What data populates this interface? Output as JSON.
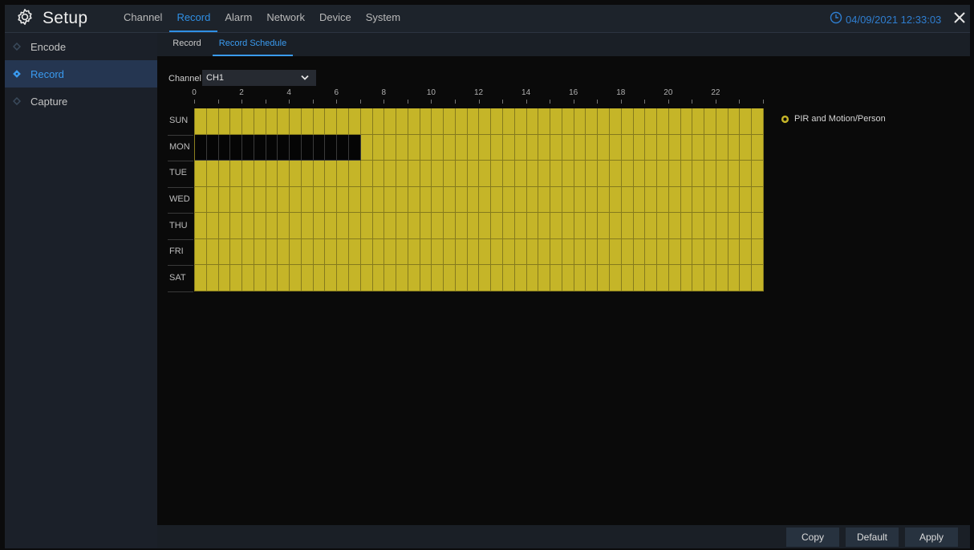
{
  "header": {
    "title": "Setup",
    "menu": [
      "Channel",
      "Record",
      "Alarm",
      "Network",
      "Device",
      "System"
    ],
    "active_menu": "Record",
    "datetime": "04/09/2021 12:33:03"
  },
  "sidebar": {
    "items": [
      {
        "label": "Encode",
        "active": false
      },
      {
        "label": "Record",
        "active": true
      },
      {
        "label": "Capture",
        "active": false
      }
    ]
  },
  "subtabs": [
    {
      "label": "Record",
      "active": false
    },
    {
      "label": "Record Schedule",
      "active": true
    }
  ],
  "channel": {
    "label": "Channel",
    "value": "CH1"
  },
  "schedule": {
    "hours": [
      "0",
      "2",
      "4",
      "6",
      "8",
      "10",
      "12",
      "14",
      "16",
      "18",
      "20",
      "22"
    ],
    "days": [
      "SUN",
      "MON",
      "TUE",
      "WED",
      "THU",
      "FRI",
      "SAT"
    ],
    "slots_per_day": 48,
    "unscheduled": {
      "MON": [
        0,
        13
      ]
    },
    "legend": "PIR and Motion/Person",
    "scheduled_color": "#c5b528",
    "unscheduled_color": "#050505"
  },
  "buttons": {
    "copy": "Copy",
    "default": "Default",
    "apply": "Apply"
  },
  "colors": {
    "accent": "#2f8fe4"
  }
}
